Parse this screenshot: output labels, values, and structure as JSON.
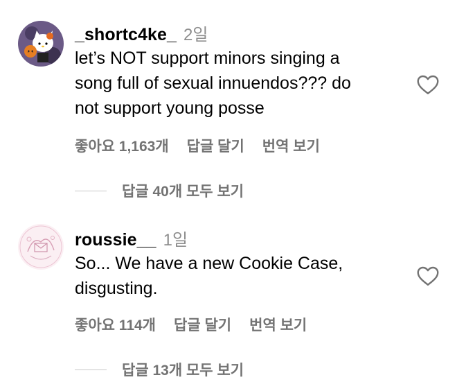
{
  "comments": [
    {
      "username": "_shortc4ke_",
      "time": "2일",
      "text_lines": [
        "let’s NOT support minors singing a",
        "song full of sexual innuendos??? do",
        "not support young posse"
      ],
      "likes": "좋아요 1,163개",
      "reply": "답글 달기",
      "translate": "번역 보기",
      "view_replies": "답글 40개 모두 보기"
    },
    {
      "username": "roussie__",
      "time": "1일",
      "text_lines": [
        "So... We have a new Cookie Case,",
        "disgusting."
      ],
      "likes": "좋아요 114개",
      "reply": "답글 달기",
      "translate": "번역 보기",
      "view_replies": "답글 13개 모두 보기"
    }
  ],
  "colors": {
    "secondary_text": "#737373",
    "timestamp": "#8e8e8e",
    "divider": "#c7c7c7"
  },
  "icons": {
    "like": "heart-outline-icon",
    "avatar1": "hello-kitty-halloween-avatar",
    "avatar2": "pink-sketch-avatar"
  }
}
